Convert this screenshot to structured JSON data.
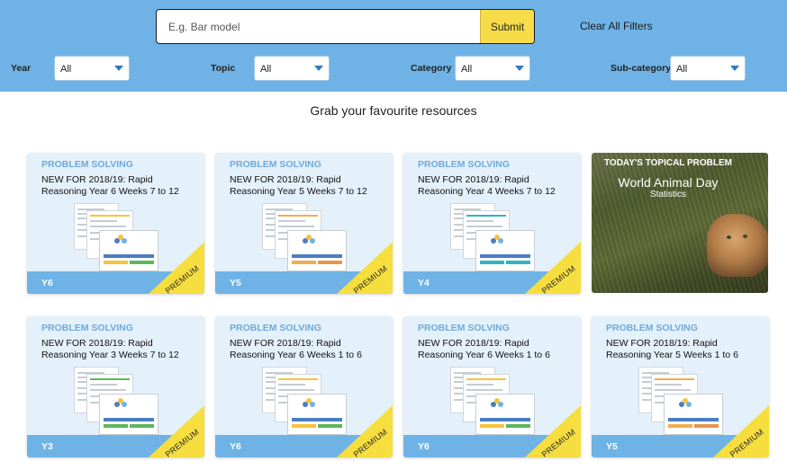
{
  "search": {
    "placeholder": "E.g. Bar model",
    "submit_label": "Submit",
    "clear_label": "Clear All Filters"
  },
  "filters": [
    {
      "label": "Year",
      "value": "All"
    },
    {
      "label": "Topic",
      "value": "All"
    },
    {
      "label": "Category",
      "value": "All"
    },
    {
      "label": "Sub-category",
      "value": "All"
    }
  ],
  "heading": "Grab your favourite resources",
  "badge": "PREMIUM",
  "cards": [
    {
      "category": "PROBLEM SOLVING",
      "title": "NEW FOR 2018/19: Rapid Reasoning Year 6 Weeks 7 to 12",
      "year": "Y6",
      "accent": "#f5c43c",
      "accent2": "#5cb85c"
    },
    {
      "category": "PROBLEM SOLVING",
      "title": "NEW FOR 2018/19: Rapid Reasoning Year 5 Weeks 7 to 12",
      "year": "Y5",
      "accent": "#f0ad4e",
      "accent2": "#e8954a"
    },
    {
      "category": "PROBLEM SOLVING",
      "title": "NEW FOR 2018/19: Rapid Reasoning Year 4 Weeks 7 to 12",
      "year": "Y4",
      "accent": "#2fb5c2",
      "accent2": "#2fb5c2"
    },
    {
      "category": "PROBLEM SOLVING",
      "title": "NEW FOR 2018/19: Rapid Reasoning Year 3 Weeks 7 to 12",
      "year": "Y3",
      "accent": "#5cb85c",
      "accent2": "#5cb85c"
    },
    {
      "category": "PROBLEM SOLVING",
      "title": "NEW FOR 2018/19: Rapid Reasoning Year 6 Weeks 1 to 6",
      "year": "Y6",
      "accent": "#f5c43c",
      "accent2": "#5cb85c"
    },
    {
      "category": "PROBLEM SOLVING",
      "title": "NEW FOR 2018/19: Rapid Reasoning Year 6 Weeks 1 to 6",
      "year": "Y6",
      "accent": "#f5c43c",
      "accent2": "#5cb85c"
    },
    {
      "category": "PROBLEM SOLVING",
      "title": "NEW FOR 2018/19: Rapid Reasoning Year 5 Weeks 1 to 6",
      "year": "Y5",
      "accent": "#f0ad4e",
      "accent2": "#e8954a"
    }
  ],
  "topical": {
    "label": "TODAY'S TOPICAL PROBLEM",
    "title": "World Animal Day",
    "subtitle": "Statistics"
  },
  "colors": {
    "header_bg": "#6fb3e6",
    "submit": "#f7dc4a",
    "card_bg": "#e4f1fb",
    "premium": "#f6de3f",
    "category_text": "#6fa9dc"
  }
}
